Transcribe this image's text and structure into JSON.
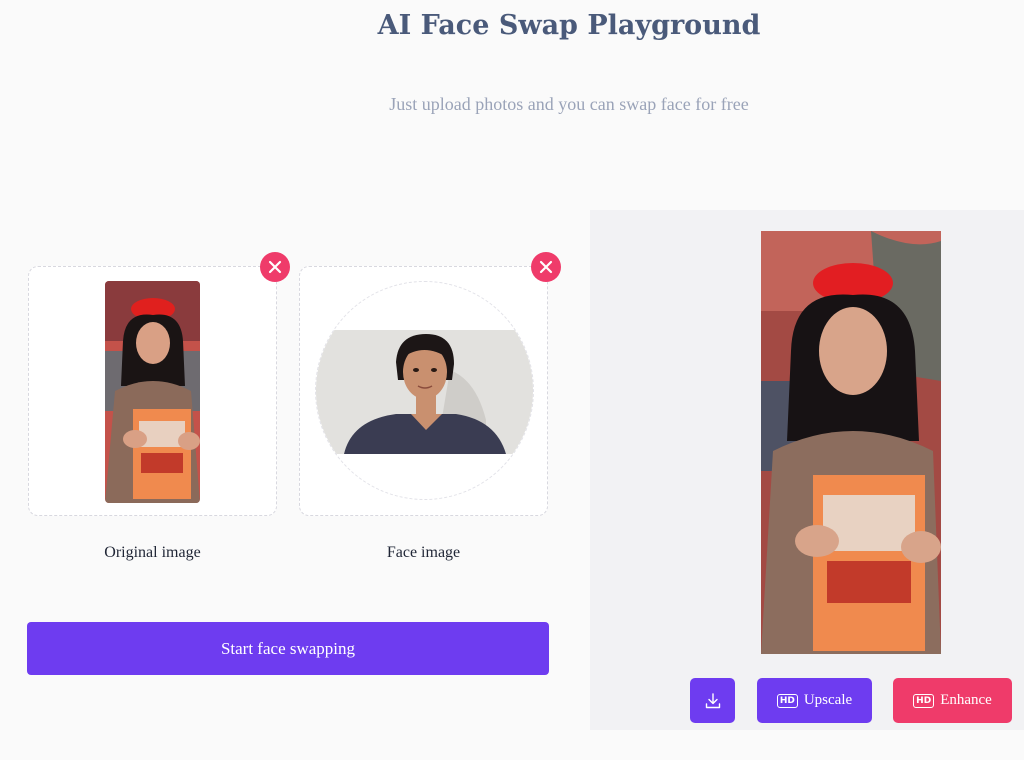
{
  "header": {
    "title": "AI Face Swap Playground",
    "subtitle": "Just upload photos and you can swap face for free"
  },
  "upload": {
    "original_label": "Original image",
    "face_label": "Face image",
    "remove_icon": "close-icon"
  },
  "actions": {
    "start_label": "Start face swapping",
    "upscale_label": "Upscale",
    "enhance_label": "Enhance",
    "hd_badge": "HD",
    "download_icon": "download-icon"
  },
  "colors": {
    "primary": "#6e3cf0",
    "danger": "#ef3b6a",
    "title": "#4a5a7a",
    "subtitle": "#9aa3b8"
  }
}
